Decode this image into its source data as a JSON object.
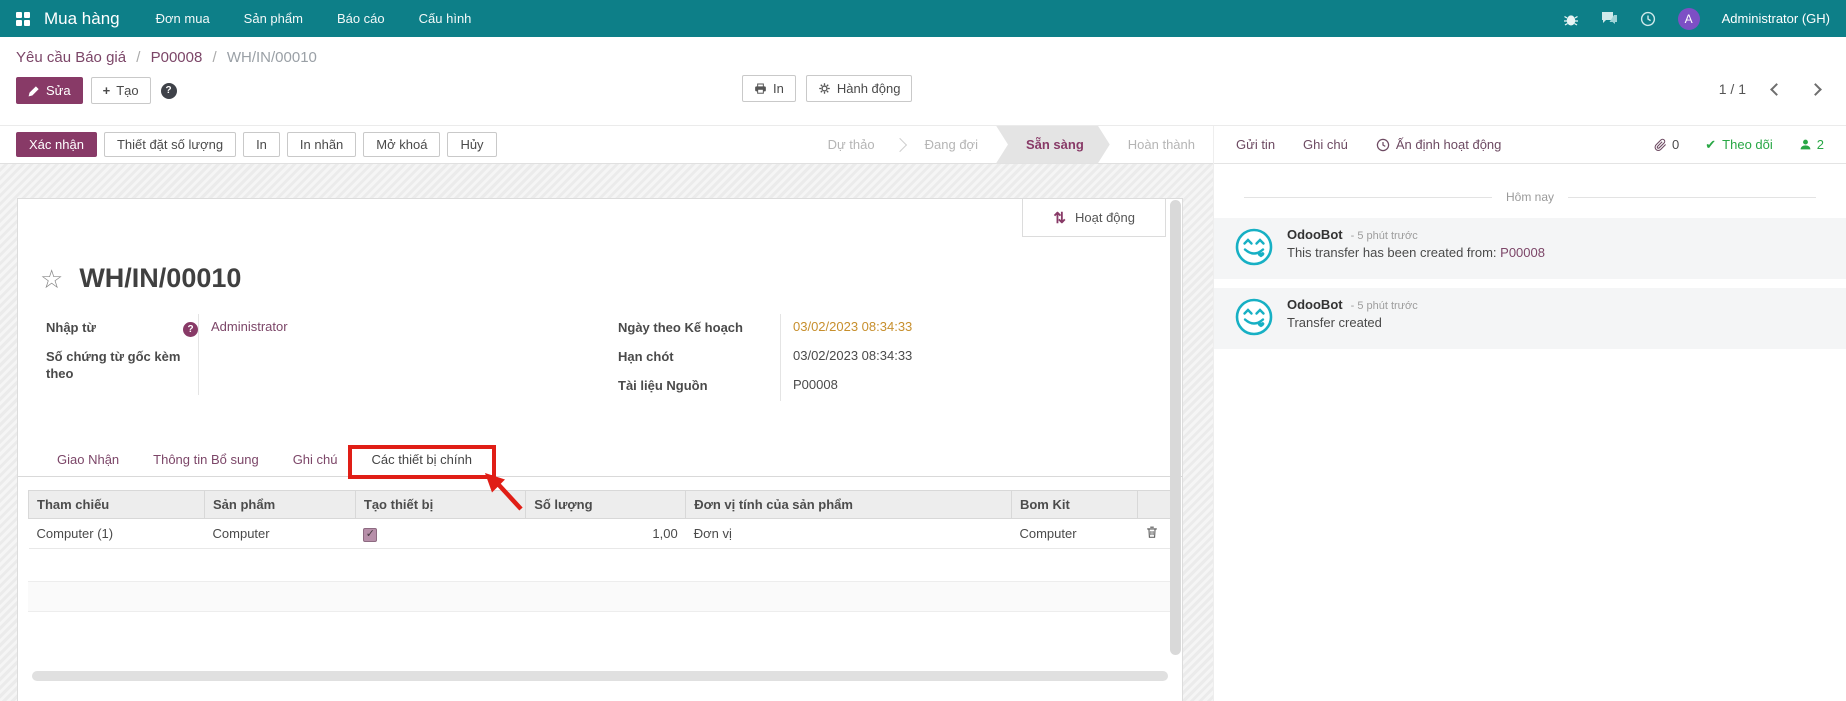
{
  "navbar": {
    "brand": "Mua hàng",
    "menus": [
      "Đơn mua",
      "Sản phẩm",
      "Báo cáo",
      "Cấu hình"
    ],
    "user_name": "Administrator (GH)",
    "user_initial": "A"
  },
  "control": {
    "breadcrumbs": [
      "Yêu cầu Báo giá",
      "P00008",
      "WH/IN/00010"
    ],
    "edit_label": "Sửa",
    "create_label": "Tạo",
    "help_label": "?",
    "print_label": "In",
    "action_label": "Hành động",
    "pager": "1 / 1"
  },
  "statusbar": {
    "buttons": [
      "Xác nhận",
      "Thiết đặt số lượng",
      "In",
      "In nhãn",
      "Mở khoá",
      "Hủy"
    ],
    "stages": [
      "Dự thảo",
      "Đang đợi",
      "Sẵn sàng",
      "Hoàn thành"
    ],
    "active_stage": "Sẵn sàng"
  },
  "sheet": {
    "activity_label": "Hoạt động",
    "title": "WH/IN/00010",
    "fields": {
      "left": [
        {
          "label": "Nhập từ",
          "value": "Administrator"
        },
        {
          "label": "Số chứng từ gốc kèm theo",
          "value": ""
        }
      ],
      "right": [
        {
          "label": "Ngày theo Kế hoạch",
          "value": "03/02/2023 08:34:33"
        },
        {
          "label": "Hạn chót",
          "value": "03/02/2023 08:34:33"
        },
        {
          "label": "Tài liệu Nguồn",
          "value": "P00008"
        }
      ]
    },
    "tabs": [
      "Giao Nhận",
      "Thông tin Bổ sung",
      "Ghi chú",
      "Các thiết bị chính"
    ],
    "active_tab": "Các thiết bị chính",
    "table": {
      "headers": [
        "Tham chiếu",
        "Sản phẩm",
        "Tạo thiết bị",
        "Số lượng",
        "Đơn vị tính của sản phẩm",
        "Bom Kit"
      ],
      "row": {
        "reference": "Computer (1)",
        "product": "Computer",
        "create_device": true,
        "check_glyph": "✓",
        "quantity": "1,00",
        "uom": "Đơn vị",
        "bom_kit": "Computer"
      }
    }
  },
  "chatter": {
    "send_label": "Gửi tin",
    "note_label": "Ghi chú",
    "activity_label": "Ấn định hoạt động",
    "attachment_count": "0",
    "follow_label": "Theo dõi",
    "follower_count": "2",
    "date_divider": "Hôm nay",
    "messages": [
      {
        "author": "OdooBot",
        "time": "- 5 phút trước",
        "text": "This transfer has been created from: ",
        "link": "P00008"
      },
      {
        "author": "OdooBot",
        "time": "- 5 phút trước",
        "text": "Transfer created",
        "link": ""
      }
    ]
  },
  "colors": {
    "navbar_teal": "#0d7f88",
    "accent_purple": "#883a67",
    "link_purple": "#7c4668",
    "date_highlight": "#c78f2d",
    "follow_green": "#28a745",
    "annotation_red": "#e01e16",
    "odoobot_teal": "#17b0c4"
  }
}
